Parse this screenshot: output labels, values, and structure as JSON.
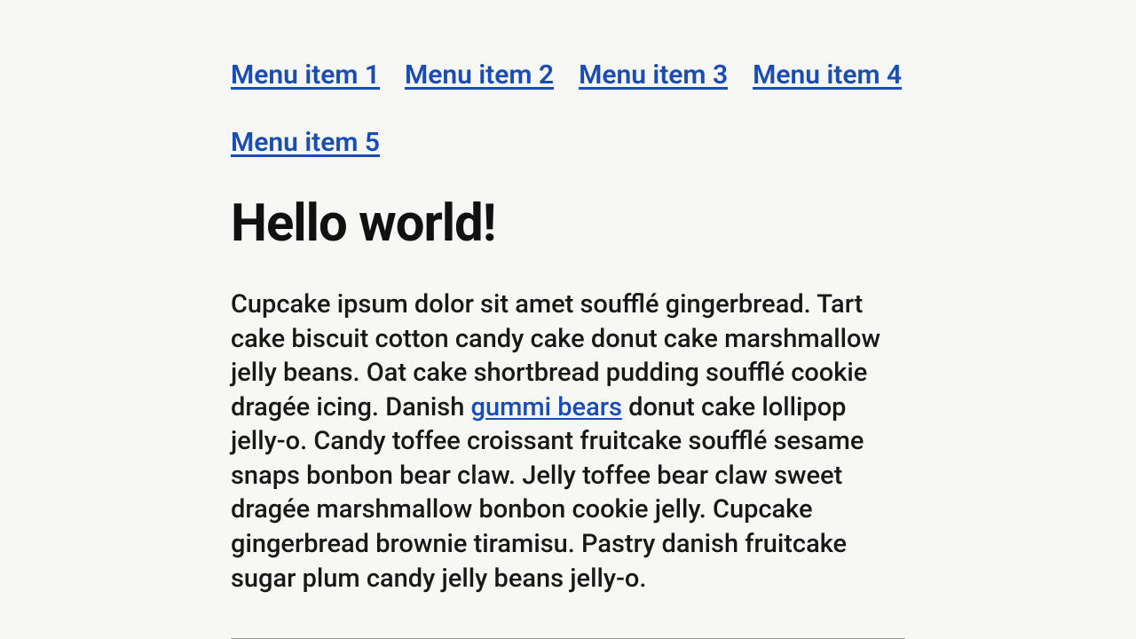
{
  "menu": {
    "items": [
      {
        "label": "Menu item 1"
      },
      {
        "label": "Menu item 2"
      },
      {
        "label": "Menu item 3"
      },
      {
        "label": "Menu item 4"
      },
      {
        "label": "Menu item 5"
      }
    ]
  },
  "heading": "Hello world!",
  "paragraph": {
    "before_link": "Cupcake ipsum dolor sit amet soufflé gingerbread. Tart cake biscuit cotton candy cake donut cake marshmallow jelly beans. Oat cake shortbread pudding soufflé cookie dragée icing. Danish ",
    "link_text": "gummi bears",
    "after_link": " donut cake lollipop jelly-o. Candy toffee croissant fruitcake soufflé sesame snaps bonbon bear claw. Jelly toffee bear claw sweet dragée marshmallow bonbon cookie jelly. Cupcake gingerbread brownie tiramisu. Pastry danish fruitcake sugar plum candy jelly beans jelly-o."
  }
}
